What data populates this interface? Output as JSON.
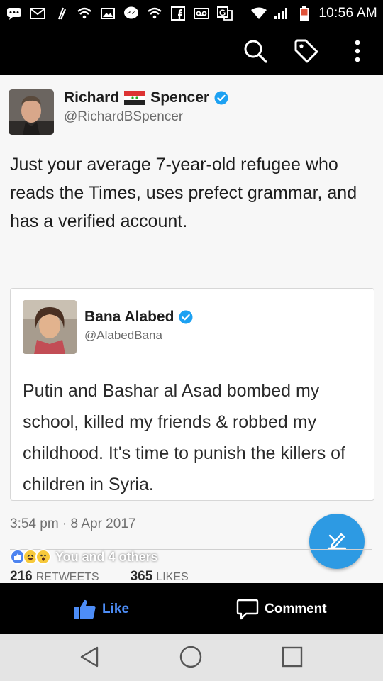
{
  "status_bar": {
    "time": "10:56 AM",
    "notification_icons": [
      "chat-icon",
      "gmail-icon",
      "clip-icon",
      "wifi-icon",
      "image-icon",
      "messenger-icon",
      "wifi-icon",
      "facebook-icon",
      "voicemail-icon",
      "google-translate-icon"
    ],
    "right_icons": [
      "wifi-icon",
      "signal-icon",
      "battery-icon"
    ]
  },
  "toolbar": {
    "icons": [
      "search-icon",
      "tag-icon",
      "more-vertical-icon"
    ]
  },
  "tweet": {
    "author_name_first": "Richard",
    "author_name_last": "Spencer",
    "handle": "@RichardBSpencer",
    "text": "Just your average 7-year-old refugee who reads the Times, uses prefect grammar, and has a verified account.",
    "timestamp": "3:54 pm · 8 Apr 2017"
  },
  "quoted_tweet": {
    "author_name": "Bana Alabed",
    "handle": "@AlabedBana",
    "text": "Putin and Bashar al Asad bombed my school, killed my friends & robbed my childhood. It's time to punish the killers of children in Syria."
  },
  "stats": {
    "retweets_count": "216",
    "retweets_label": "RETWEETS",
    "likes_count": "365",
    "likes_label": "LIKES"
  },
  "reactions": {
    "icons": [
      "like-reaction-icon",
      "haha-reaction-icon",
      "wow-reaction-icon"
    ],
    "text": "You and 4 others"
  },
  "actions": {
    "like_label": "Like",
    "comment_label": "Comment"
  },
  "nav": {
    "icons": [
      "back-icon",
      "home-icon",
      "recents-icon"
    ]
  },
  "colors": {
    "verified_blue": "#1da1f2",
    "fab_blue": "#2d9ae3",
    "like_blue": "#4d8df7",
    "status_bar": "#000000",
    "nav_bar": "#e4e4e4"
  }
}
